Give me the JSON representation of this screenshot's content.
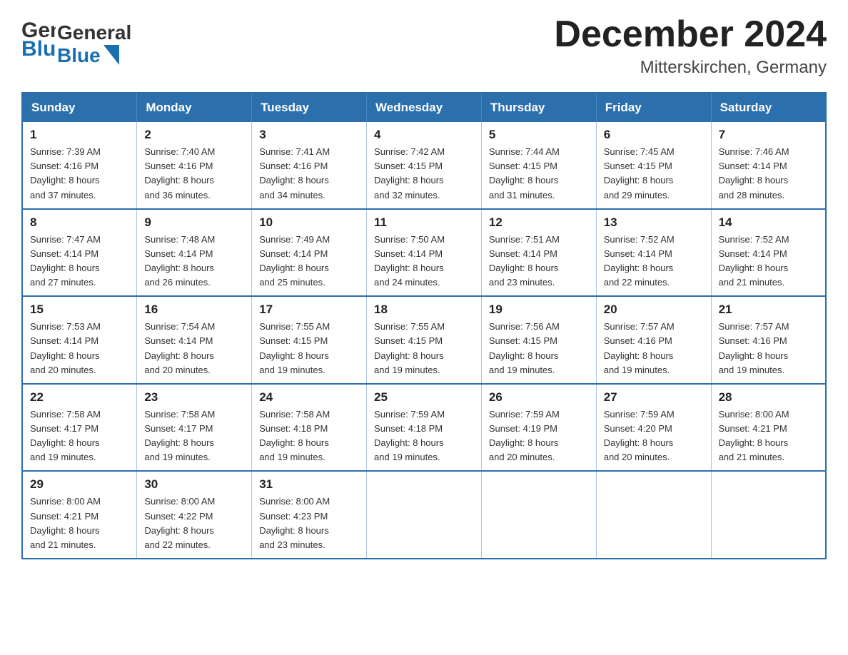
{
  "header": {
    "logo_general": "General",
    "logo_blue": "Blue",
    "month_title": "December 2024",
    "location": "Mitterskirchen, Germany"
  },
  "weekdays": [
    "Sunday",
    "Monday",
    "Tuesday",
    "Wednesday",
    "Thursday",
    "Friday",
    "Saturday"
  ],
  "weeks": [
    [
      {
        "day": "1",
        "sunrise": "7:39 AM",
        "sunset": "4:16 PM",
        "daylight": "8 hours and 37 minutes."
      },
      {
        "day": "2",
        "sunrise": "7:40 AM",
        "sunset": "4:16 PM",
        "daylight": "8 hours and 36 minutes."
      },
      {
        "day": "3",
        "sunrise": "7:41 AM",
        "sunset": "4:16 PM",
        "daylight": "8 hours and 34 minutes."
      },
      {
        "day": "4",
        "sunrise": "7:42 AM",
        "sunset": "4:15 PM",
        "daylight": "8 hours and 32 minutes."
      },
      {
        "day": "5",
        "sunrise": "7:44 AM",
        "sunset": "4:15 PM",
        "daylight": "8 hours and 31 minutes."
      },
      {
        "day": "6",
        "sunrise": "7:45 AM",
        "sunset": "4:15 PM",
        "daylight": "8 hours and 29 minutes."
      },
      {
        "day": "7",
        "sunrise": "7:46 AM",
        "sunset": "4:14 PM",
        "daylight": "8 hours and 28 minutes."
      }
    ],
    [
      {
        "day": "8",
        "sunrise": "7:47 AM",
        "sunset": "4:14 PM",
        "daylight": "8 hours and 27 minutes."
      },
      {
        "day": "9",
        "sunrise": "7:48 AM",
        "sunset": "4:14 PM",
        "daylight": "8 hours and 26 minutes."
      },
      {
        "day": "10",
        "sunrise": "7:49 AM",
        "sunset": "4:14 PM",
        "daylight": "8 hours and 25 minutes."
      },
      {
        "day": "11",
        "sunrise": "7:50 AM",
        "sunset": "4:14 PM",
        "daylight": "8 hours and 24 minutes."
      },
      {
        "day": "12",
        "sunrise": "7:51 AM",
        "sunset": "4:14 PM",
        "daylight": "8 hours and 23 minutes."
      },
      {
        "day": "13",
        "sunrise": "7:52 AM",
        "sunset": "4:14 PM",
        "daylight": "8 hours and 22 minutes."
      },
      {
        "day": "14",
        "sunrise": "7:52 AM",
        "sunset": "4:14 PM",
        "daylight": "8 hours and 21 minutes."
      }
    ],
    [
      {
        "day": "15",
        "sunrise": "7:53 AM",
        "sunset": "4:14 PM",
        "daylight": "8 hours and 20 minutes."
      },
      {
        "day": "16",
        "sunrise": "7:54 AM",
        "sunset": "4:14 PM",
        "daylight": "8 hours and 20 minutes."
      },
      {
        "day": "17",
        "sunrise": "7:55 AM",
        "sunset": "4:15 PM",
        "daylight": "8 hours and 19 minutes."
      },
      {
        "day": "18",
        "sunrise": "7:55 AM",
        "sunset": "4:15 PM",
        "daylight": "8 hours and 19 minutes."
      },
      {
        "day": "19",
        "sunrise": "7:56 AM",
        "sunset": "4:15 PM",
        "daylight": "8 hours and 19 minutes."
      },
      {
        "day": "20",
        "sunrise": "7:57 AM",
        "sunset": "4:16 PM",
        "daylight": "8 hours and 19 minutes."
      },
      {
        "day": "21",
        "sunrise": "7:57 AM",
        "sunset": "4:16 PM",
        "daylight": "8 hours and 19 minutes."
      }
    ],
    [
      {
        "day": "22",
        "sunrise": "7:58 AM",
        "sunset": "4:17 PM",
        "daylight": "8 hours and 19 minutes."
      },
      {
        "day": "23",
        "sunrise": "7:58 AM",
        "sunset": "4:17 PM",
        "daylight": "8 hours and 19 minutes."
      },
      {
        "day": "24",
        "sunrise": "7:58 AM",
        "sunset": "4:18 PM",
        "daylight": "8 hours and 19 minutes."
      },
      {
        "day": "25",
        "sunrise": "7:59 AM",
        "sunset": "4:18 PM",
        "daylight": "8 hours and 19 minutes."
      },
      {
        "day": "26",
        "sunrise": "7:59 AM",
        "sunset": "4:19 PM",
        "daylight": "8 hours and 20 minutes."
      },
      {
        "day": "27",
        "sunrise": "7:59 AM",
        "sunset": "4:20 PM",
        "daylight": "8 hours and 20 minutes."
      },
      {
        "day": "28",
        "sunrise": "8:00 AM",
        "sunset": "4:21 PM",
        "daylight": "8 hours and 21 minutes."
      }
    ],
    [
      {
        "day": "29",
        "sunrise": "8:00 AM",
        "sunset": "4:21 PM",
        "daylight": "8 hours and 21 minutes."
      },
      {
        "day": "30",
        "sunrise": "8:00 AM",
        "sunset": "4:22 PM",
        "daylight": "8 hours and 22 minutes."
      },
      {
        "day": "31",
        "sunrise": "8:00 AM",
        "sunset": "4:23 PM",
        "daylight": "8 hours and 23 minutes."
      },
      null,
      null,
      null,
      null
    ]
  ],
  "labels": {
    "sunrise": "Sunrise: ",
    "sunset": "Sunset: ",
    "daylight": "Daylight: "
  }
}
